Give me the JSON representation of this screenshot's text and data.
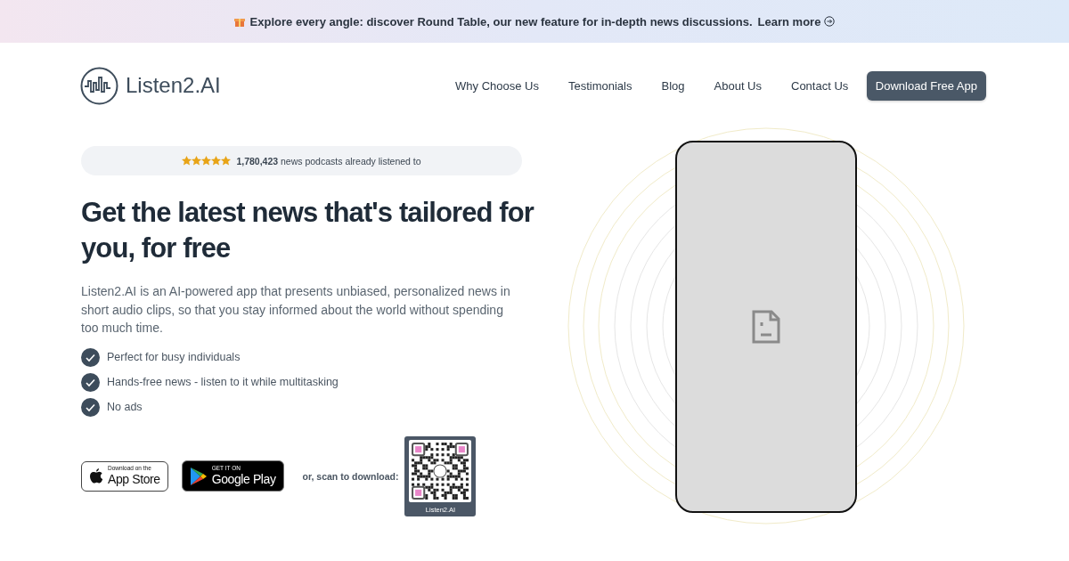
{
  "banner": {
    "text": "Explore every angle: discover Round Table, our new feature for in-depth news discussions.",
    "link": "Learn more"
  },
  "header": {
    "logo": "Listen2.AI",
    "nav": [
      "Why Choose Us",
      "Testimonials",
      "Blog",
      "About Us",
      "Contact Us"
    ],
    "cta": "Download Free App"
  },
  "hero": {
    "stats": {
      "stars": 5,
      "text": "**1,780,423** news podcasts already listened to"
    },
    "title": "Get the latest news that's tailored for you, for free",
    "description": "Listen2.AI is an AI-powered app that presents unbiased, personalized news in short audio clips, so that you stay informed about the world without spending too much time.",
    "features": [
      {
        "text": "Perfect for busy individuals",
        "checked": true
      },
      {
        "text": "Hands-free news - listen to it while multitasking",
        "checked": true
      },
      {
        "text": "No ads",
        "checked": true
      }
    ],
    "stores": [
      {
        "kind": "apple",
        "small": "Download on the",
        "big": "App Store"
      },
      {
        "kind": "google",
        "small": "GET IT ON",
        "big": "Google Play"
      }
    ],
    "scan_label": "or, scan to download:",
    "qr_caption": "Listen2.AI"
  }
}
